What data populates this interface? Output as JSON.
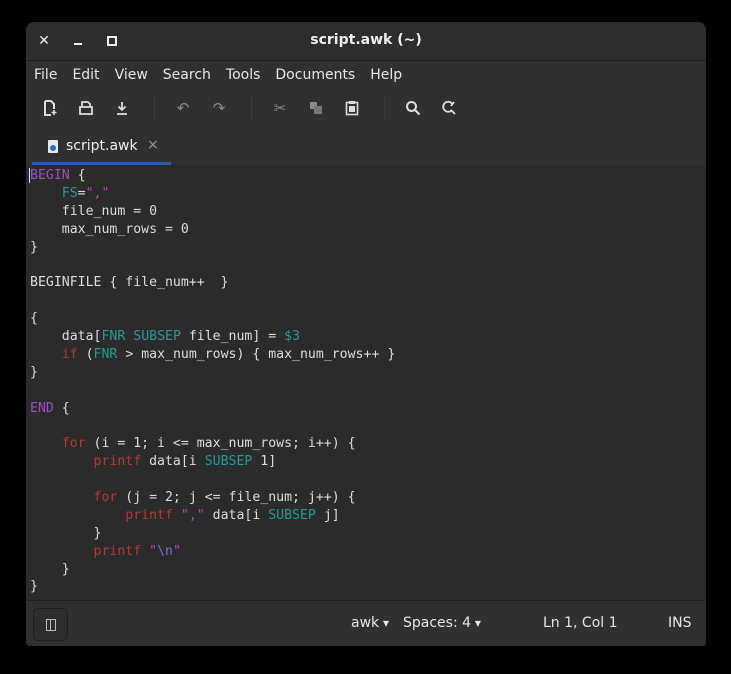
{
  "window": {
    "title": "script.awk (~)"
  },
  "menu": [
    "File",
    "Edit",
    "View",
    "Search",
    "Tools",
    "Documents",
    "Help"
  ],
  "tab": {
    "label": "script.awk",
    "close": "×"
  },
  "code": {
    "lines": [
      [
        [
          "BEGIN",
          "k"
        ],
        [
          " {",
          ""
        ]
      ],
      [
        [
          "    ",
          ""
        ],
        [
          "FS",
          "v"
        ],
        [
          "=",
          ""
        ],
        [
          "\",\"",
          "s"
        ]
      ],
      [
        [
          "    file_num = 0",
          ""
        ]
      ],
      [
        [
          "    max_num_rows = 0",
          ""
        ]
      ],
      [
        [
          "}",
          ""
        ]
      ],
      [
        [
          "",
          ""
        ]
      ],
      [
        [
          "BEGINFILE { file_num++  }",
          ""
        ]
      ],
      [
        [
          "",
          ""
        ]
      ],
      [
        [
          "{",
          ""
        ]
      ],
      [
        [
          "    data[",
          ""
        ],
        [
          "FNR",
          "v"
        ],
        [
          " ",
          ""
        ],
        [
          "SUBSEP",
          "v"
        ],
        [
          " file_num] = ",
          ""
        ],
        [
          "$3",
          "v"
        ]
      ],
      [
        [
          "    ",
          ""
        ],
        [
          "if",
          "r"
        ],
        [
          " (",
          ""
        ],
        [
          "FNR",
          "v"
        ],
        [
          " > max_num_rows) { max_num_rows++ }",
          ""
        ]
      ],
      [
        [
          "}",
          ""
        ]
      ],
      [
        [
          "",
          ""
        ]
      ],
      [
        [
          "END",
          "k"
        ],
        [
          " {",
          ""
        ]
      ],
      [
        [
          "",
          ""
        ]
      ],
      [
        [
          "    ",
          ""
        ],
        [
          "for",
          "r"
        ],
        [
          " (i = 1; i <= max_num_rows; i++) {",
          ""
        ]
      ],
      [
        [
          "        ",
          ""
        ],
        [
          "printf",
          "r"
        ],
        [
          " data[i ",
          ""
        ],
        [
          "SUBSEP",
          "v"
        ],
        [
          " 1]",
          ""
        ]
      ],
      [
        [
          "",
          ""
        ]
      ],
      [
        [
          "        ",
          ""
        ],
        [
          "for",
          "r"
        ],
        [
          " (j = 2; j <= file_num; j++) {",
          ""
        ]
      ],
      [
        [
          "            ",
          ""
        ],
        [
          "printf",
          "r"
        ],
        [
          " ",
          ""
        ],
        [
          "\",\"",
          "s"
        ],
        [
          " data[i ",
          ""
        ],
        [
          "SUBSEP",
          "v"
        ],
        [
          " j]",
          ""
        ]
      ],
      [
        [
          "        }",
          ""
        ]
      ],
      [
        [
          "        ",
          ""
        ],
        [
          "printf",
          "r"
        ],
        [
          " ",
          ""
        ],
        [
          "\"",
          "s"
        ],
        [
          "\\n",
          "e"
        ],
        [
          "\"",
          "s"
        ]
      ],
      [
        [
          "    }",
          ""
        ]
      ],
      [
        [
          "}",
          ""
        ]
      ]
    ]
  },
  "status": {
    "language": "awk",
    "indent": "Spaces: 4",
    "position": "Ln 1, Col 1",
    "mode": "INS"
  }
}
